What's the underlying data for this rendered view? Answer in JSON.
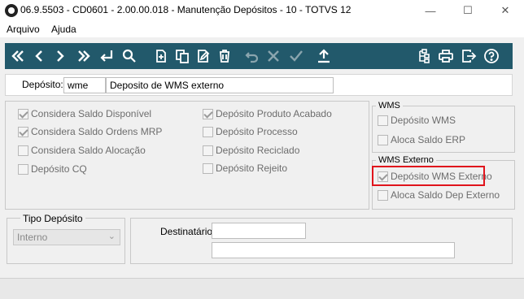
{
  "window": {
    "title": "06.9.5503 - CD0601 - 2.00.00.018 - Manutenção Depósitos - 10 - TOTVS 12",
    "minimize": "—",
    "maximize": "☐",
    "close": "✕"
  },
  "menu": {
    "items": [
      "Arquivo",
      "Ajuda"
    ]
  },
  "toolbar": {
    "bg": "#22596b",
    "icons": [
      "first-icon",
      "previous-icon",
      "next-icon",
      "last-icon",
      "goto-icon",
      "search-icon",
      "new-icon",
      "copy-icon",
      "edit-icon",
      "delete-icon",
      "undo-icon",
      "cancel-icon",
      "save-icon",
      "upload-icon",
      "tree-icon",
      "print-icon",
      "exit-icon",
      "help-icon"
    ]
  },
  "header": {
    "label": "Depósito:",
    "code": "wme",
    "description": "Deposito de WMS externo"
  },
  "options": {
    "col1": [
      {
        "label": "Considera Saldo Disponível",
        "checked": true
      },
      {
        "label": "Considera Saldo Ordens MRP",
        "checked": true
      },
      {
        "label": "Considera Saldo Alocação",
        "checked": false
      },
      {
        "label": "Depósito CQ",
        "checked": false
      }
    ],
    "col2": [
      {
        "label": "Depósito Produto Acabado",
        "checked": true
      },
      {
        "label": "Depósito Processo",
        "checked": false
      },
      {
        "label": "Depósito Reciclado",
        "checked": false
      },
      {
        "label": "Depósito Rejeito",
        "checked": false
      }
    ]
  },
  "wms": {
    "title": "WMS",
    "items": [
      {
        "label": "Depósito WMS",
        "checked": false
      },
      {
        "label": "Aloca Saldo ERP",
        "checked": false
      }
    ]
  },
  "wms_externo": {
    "title": "WMS Externo",
    "items": [
      {
        "label": "Depósito WMS Externo",
        "checked": true
      },
      {
        "label": "Aloca Saldo Dep Externo",
        "checked": false
      }
    ],
    "highlight_color": "#e0141c"
  },
  "tipo": {
    "title": "Tipo Depósito",
    "value": "Interno"
  },
  "destinatario": {
    "label": "Destinatário:",
    "value1": "",
    "value2": ""
  }
}
